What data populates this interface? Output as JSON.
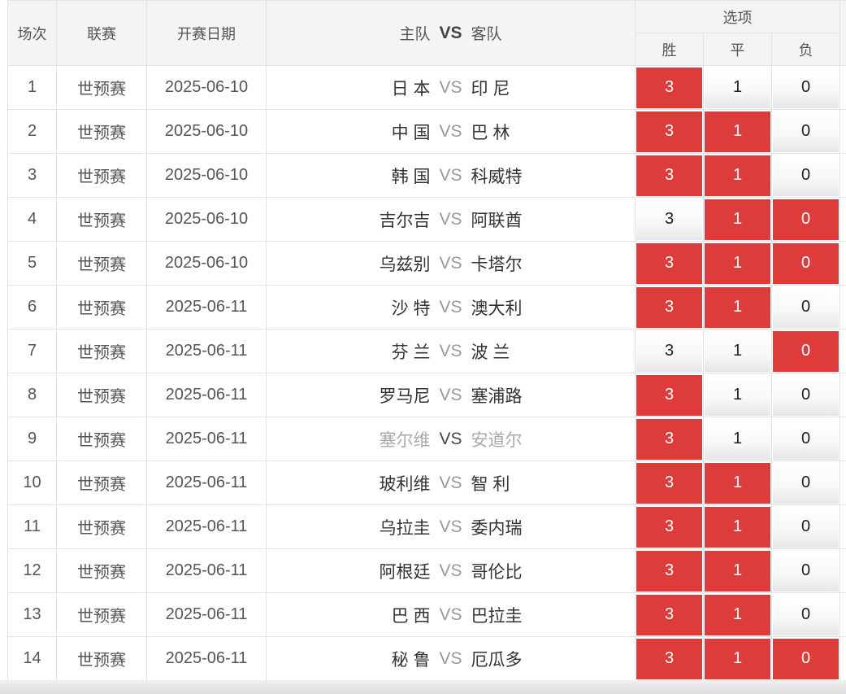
{
  "header": {
    "index": "场次",
    "league": "联赛",
    "date": "开赛日期",
    "home": "主队",
    "vs": "VS",
    "away": "客队",
    "options": "选项",
    "win": "胜",
    "draw": "平",
    "lose": "负"
  },
  "colors": {
    "selected": "#de3b3b",
    "unselected": "#f2f2f2"
  },
  "rows": [
    {
      "index": "1",
      "league": "世预赛",
      "date": "2025-06-10",
      "home": "日 本",
      "vs": "VS",
      "away": "印 尼",
      "win": "3",
      "draw": "1",
      "lose": "0",
      "sel": [
        true,
        false,
        false
      ],
      "dim": false
    },
    {
      "index": "2",
      "league": "世预赛",
      "date": "2025-06-10",
      "home": "中 国",
      "vs": "VS",
      "away": "巴 林",
      "win": "3",
      "draw": "1",
      "lose": "0",
      "sel": [
        true,
        true,
        false
      ],
      "dim": false
    },
    {
      "index": "3",
      "league": "世预赛",
      "date": "2025-06-10",
      "home": "韩 国",
      "vs": "VS",
      "away": "科威特",
      "win": "3",
      "draw": "1",
      "lose": "0",
      "sel": [
        true,
        true,
        false
      ],
      "dim": false
    },
    {
      "index": "4",
      "league": "世预赛",
      "date": "2025-06-10",
      "home": "吉尔吉",
      "vs": "VS",
      "away": "阿联酋",
      "win": "3",
      "draw": "1",
      "lose": "0",
      "sel": [
        false,
        true,
        true
      ],
      "dim": false
    },
    {
      "index": "5",
      "league": "世预赛",
      "date": "2025-06-10",
      "home": "乌兹别",
      "vs": "VS",
      "away": "卡塔尔",
      "win": "3",
      "draw": "1",
      "lose": "0",
      "sel": [
        true,
        true,
        true
      ],
      "dim": false
    },
    {
      "index": "6",
      "league": "世预赛",
      "date": "2025-06-11",
      "home": "沙 特",
      "vs": "VS",
      "away": "澳大利",
      "win": "3",
      "draw": "1",
      "lose": "0",
      "sel": [
        true,
        true,
        false
      ],
      "dim": false
    },
    {
      "index": "7",
      "league": "世预赛",
      "date": "2025-06-11",
      "home": "芬 兰",
      "vs": "VS",
      "away": "波 兰",
      "win": "3",
      "draw": "1",
      "lose": "0",
      "sel": [
        false,
        false,
        true
      ],
      "dim": false
    },
    {
      "index": "8",
      "league": "世预赛",
      "date": "2025-06-11",
      "home": "罗马尼",
      "vs": "VS",
      "away": "塞浦路",
      "win": "3",
      "draw": "1",
      "lose": "0",
      "sel": [
        true,
        false,
        false
      ],
      "dim": false
    },
    {
      "index": "9",
      "league": "世预赛",
      "date": "2025-06-11",
      "home": "塞尔维",
      "vs": "VS",
      "away": "安道尔",
      "win": "3",
      "draw": "1",
      "lose": "0",
      "sel": [
        true,
        false,
        false
      ],
      "dim": true
    },
    {
      "index": "10",
      "league": "世预赛",
      "date": "2025-06-11",
      "home": "玻利维",
      "vs": "VS",
      "away": "智 利",
      "win": "3",
      "draw": "1",
      "lose": "0",
      "sel": [
        true,
        true,
        false
      ],
      "dim": false
    },
    {
      "index": "11",
      "league": "世预赛",
      "date": "2025-06-11",
      "home": "乌拉圭",
      "vs": "VS",
      "away": "委内瑞",
      "win": "3",
      "draw": "1",
      "lose": "0",
      "sel": [
        true,
        true,
        false
      ],
      "dim": false
    },
    {
      "index": "12",
      "league": "世预赛",
      "date": "2025-06-11",
      "home": "阿根廷",
      "vs": "VS",
      "away": "哥伦比",
      "win": "3",
      "draw": "1",
      "lose": "0",
      "sel": [
        true,
        true,
        false
      ],
      "dim": false
    },
    {
      "index": "13",
      "league": "世预赛",
      "date": "2025-06-11",
      "home": "巴 西",
      "vs": "VS",
      "away": "巴拉圭",
      "win": "3",
      "draw": "1",
      "lose": "0",
      "sel": [
        true,
        true,
        false
      ],
      "dim": false
    },
    {
      "index": "14",
      "league": "世预赛",
      "date": "2025-06-11",
      "home": "秘 鲁",
      "vs": "VS",
      "away": "厄瓜多",
      "win": "3",
      "draw": "1",
      "lose": "0",
      "sel": [
        true,
        true,
        true
      ],
      "dim": false
    }
  ]
}
